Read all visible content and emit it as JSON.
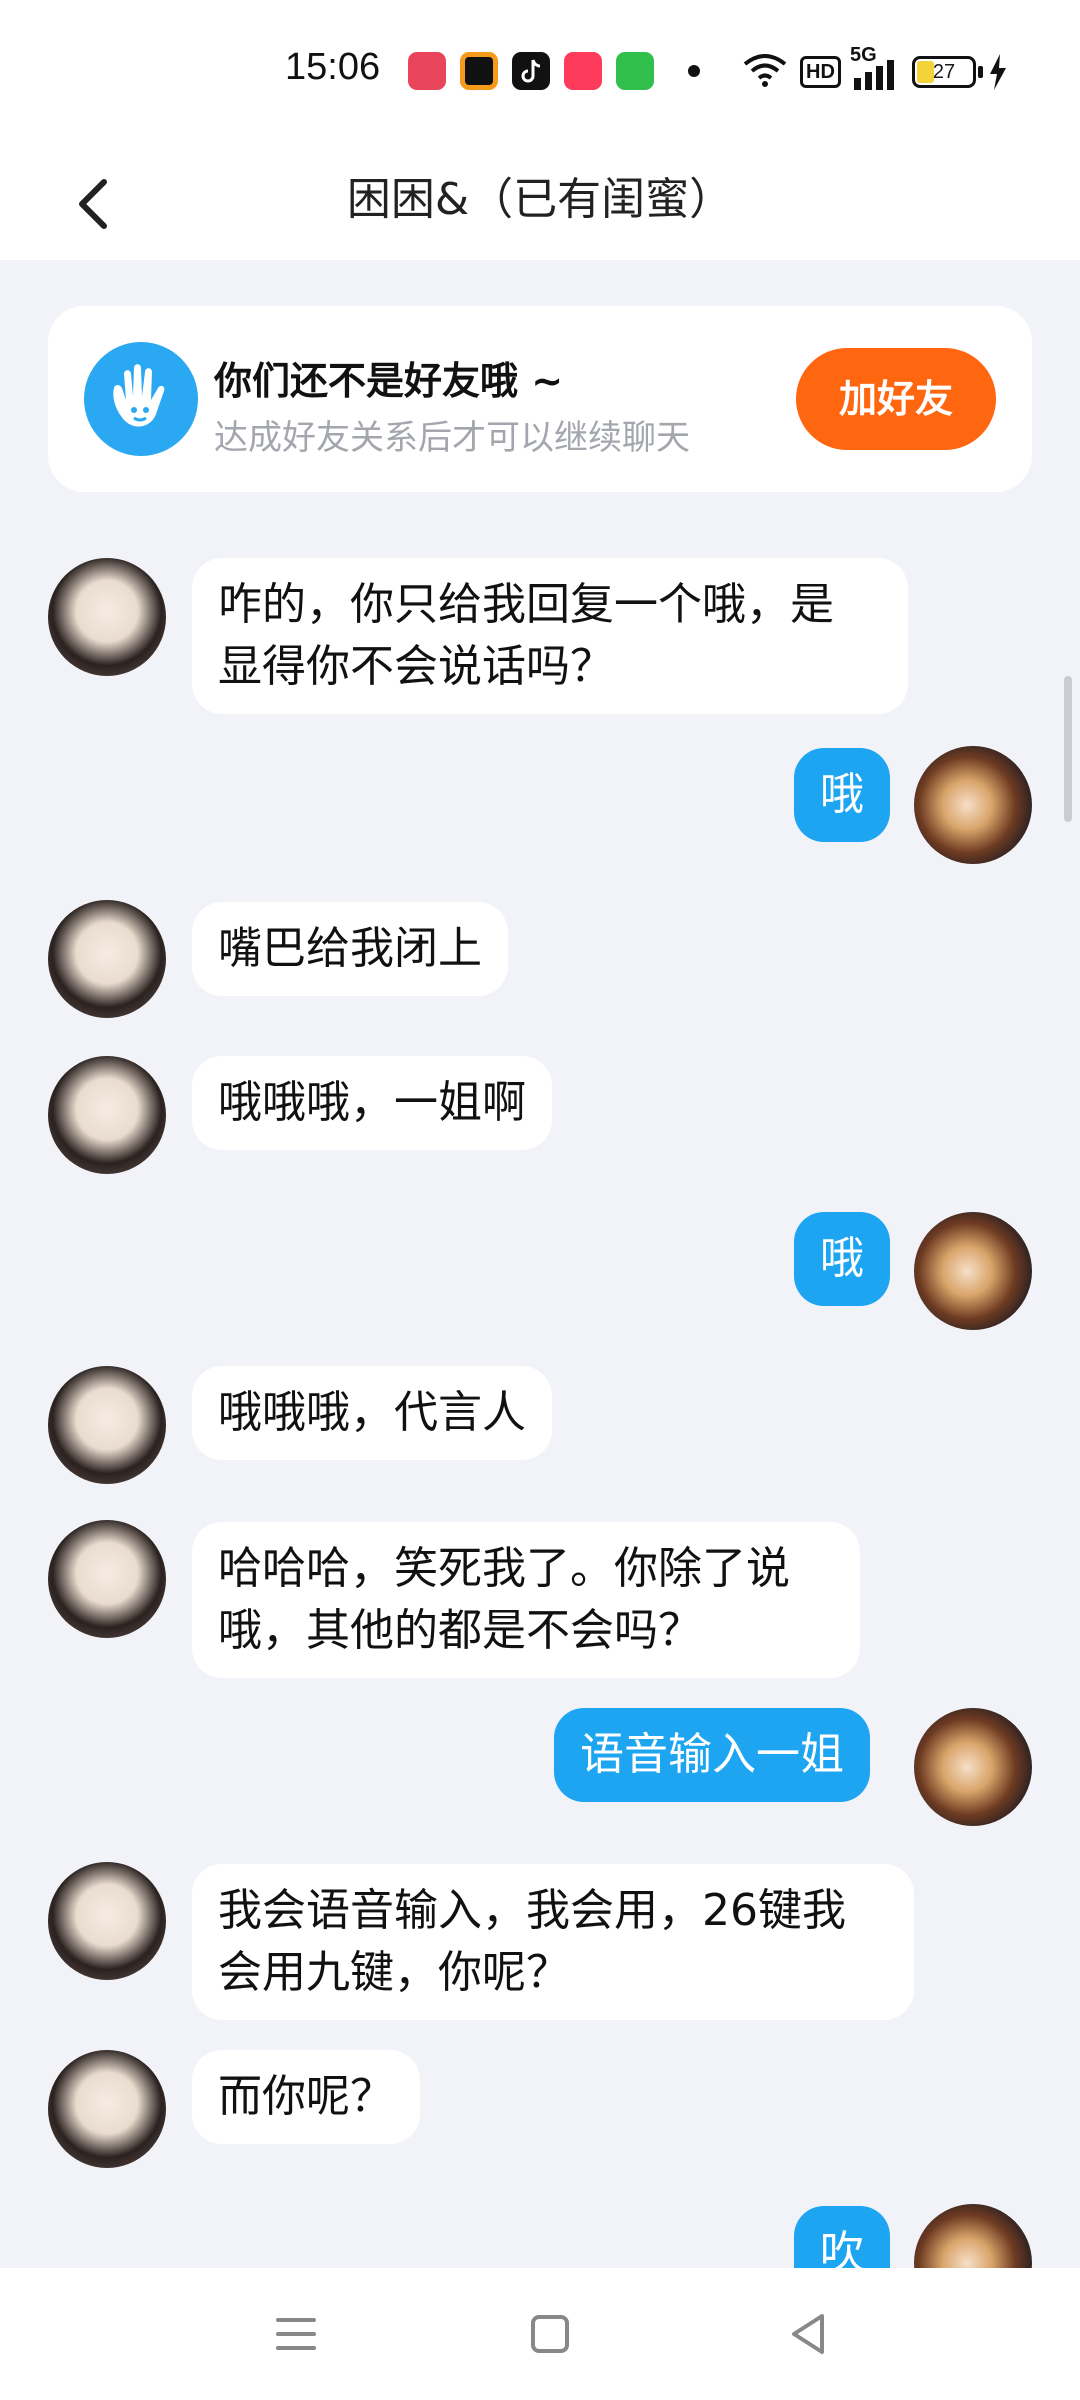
{
  "status_bar": {
    "time": "15:06",
    "battery": "27",
    "network": "5G",
    "hd": "HD"
  },
  "header": {
    "title": "困困&（已有闺蜜）"
  },
  "friend_card": {
    "title": "你们还不是好友哦 ~",
    "subtitle": "达成好友关系后才可以继续聊天",
    "add_button": "加好友"
  },
  "messages": [
    {
      "side": "left",
      "text_lines": [
        "咋的，你只给我回复一个哦，是",
        "显得你不会说话吗？"
      ]
    },
    {
      "side": "right",
      "text": "哦"
    },
    {
      "side": "left",
      "text": "嘴巴给我闭上"
    },
    {
      "side": "left",
      "text": "哦哦哦，一姐啊"
    },
    {
      "side": "right",
      "text": "哦"
    },
    {
      "side": "left",
      "text": "哦哦哦，代言人"
    },
    {
      "side": "left",
      "text_lines": [
        "哈哈哈，笑死我了。你除了说",
        "哦，其他的都是不会吗？"
      ]
    },
    {
      "side": "right",
      "text": "语音输入一姐"
    },
    {
      "side": "left",
      "text_lines": [
        "我会语音输入，我会用，26键我",
        "会用九键，你呢？"
      ]
    },
    {
      "side": "left",
      "text": "而你呢？"
    },
    {
      "side": "right",
      "text": "吹"
    }
  ],
  "icons": {
    "back": "chevron-left-icon",
    "hand": "hand-wave-icon",
    "nav_menu": "menu-icon",
    "nav_home": "home-square-icon",
    "nav_back": "triangle-back-icon"
  },
  "colors": {
    "accent_blue": "#1ea5f2",
    "add_orange": "#ff6610",
    "background": "#f1f3f8"
  }
}
